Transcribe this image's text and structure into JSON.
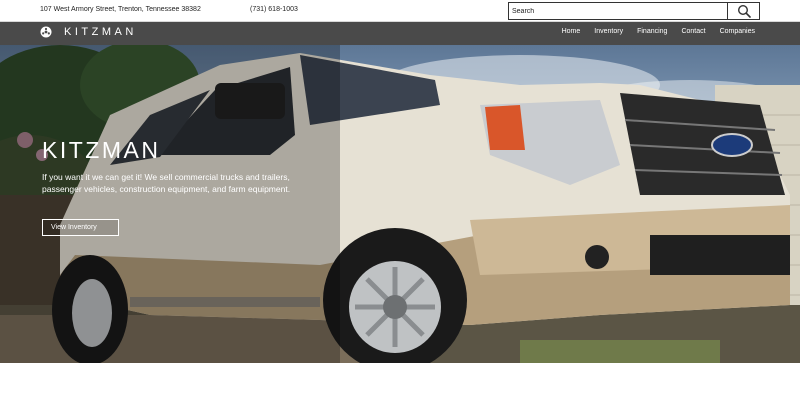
{
  "topbar": {
    "address": "107 West Armory Street, Trenton, Tennessee 38382",
    "phone": "(731) 618-1003",
    "search_placeholder": "Search"
  },
  "navbar": {
    "brand": "KITZMAN",
    "items": [
      {
        "label": "Home"
      },
      {
        "label": "Inventory"
      },
      {
        "label": "Financing"
      },
      {
        "label": "Contact"
      },
      {
        "label": "Companies"
      }
    ]
  },
  "hero": {
    "title": "KITZMAN",
    "description": "If you want it we can get it! We sell commercial trucks and trailers, passenger vehicles, construction equipment, and farm equipment.",
    "button_label": "View Inventory"
  }
}
